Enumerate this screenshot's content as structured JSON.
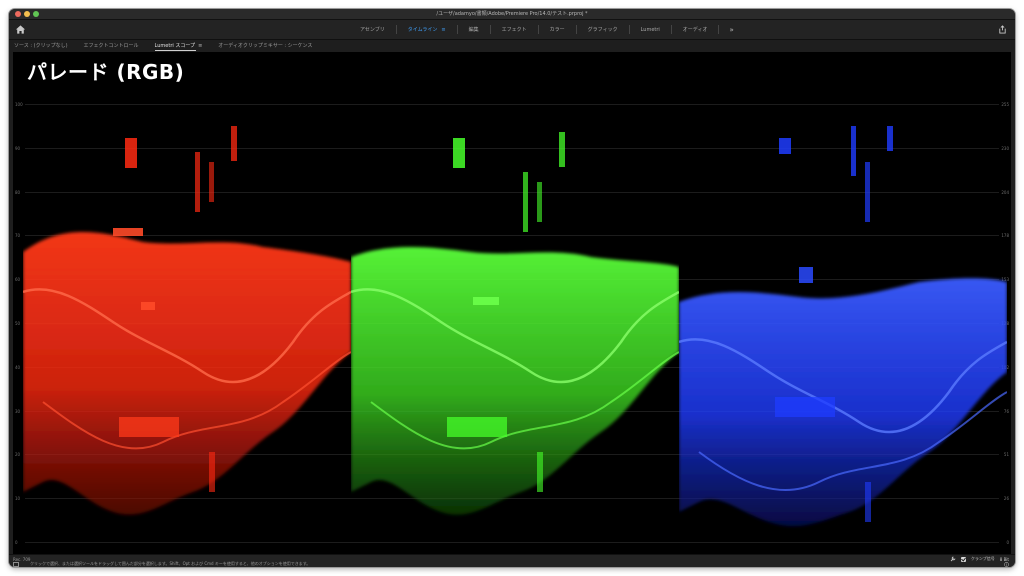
{
  "window": {
    "title": "/ユーザ/adamyo/書類/Adobe/Premiere Pro/14.0/テスト.prproj *"
  },
  "workspaces": {
    "tabs": [
      {
        "label": "アセンブリ",
        "active": false
      },
      {
        "label": "タイムライン",
        "active": true,
        "menu": "≡"
      },
      {
        "label": "編集",
        "active": false
      },
      {
        "label": "エフェクト",
        "active": false
      },
      {
        "label": "カラー",
        "active": false
      },
      {
        "label": "グラフィック",
        "active": false
      },
      {
        "label": "Lumetri",
        "active": false
      },
      {
        "label": "オーディオ",
        "active": false
      }
    ],
    "more_label": "»",
    "accent_color": "#3f9cf2"
  },
  "panel_tabs": [
    {
      "label": "ソース : (クリップなし)",
      "active": false
    },
    {
      "label": "エフェクトコントロール",
      "active": false
    },
    {
      "label": "Lumetri スコープ",
      "active": true,
      "close": "≡"
    },
    {
      "label": "オーディオクリップミキサー : シーケンス",
      "active": false
    }
  ],
  "scope": {
    "title": "パレード (RGB)",
    "left_axis": [
      "100",
      "90",
      "80",
      "70",
      "60",
      "50",
      "40",
      "30",
      "20",
      "10",
      "0"
    ],
    "right_axis": [
      "255",
      "230",
      "204",
      "178",
      "153",
      "128",
      "102",
      "76",
      "51",
      "26",
      "0"
    ],
    "channels": [
      {
        "name": "R",
        "color": "#ff2a12"
      },
      {
        "name": "G",
        "color": "#46ff2a"
      },
      {
        "name": "B",
        "color": "#1f3cff"
      }
    ]
  },
  "bottom": {
    "bit_depth_label": "Rec. 709",
    "status_text": "クリックで選択、または選択ツールをドラッグして囲んだ部分を選択します。Shift、Opt および Cmd キーを使用すると、他のオプションを使用できます。",
    "clamp_label": "クランプ信号",
    "clamp_checked": true,
    "bits_value": "8 Bit"
  }
}
